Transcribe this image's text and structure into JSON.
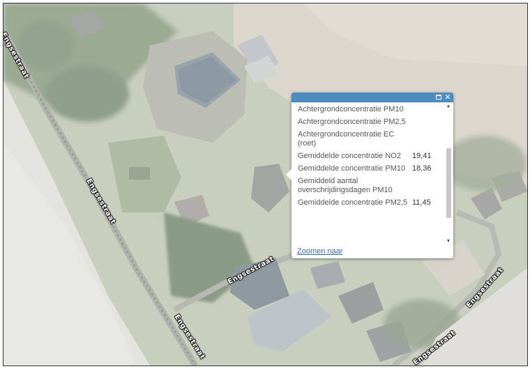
{
  "map": {
    "streets": [
      {
        "id": "street-label-1",
        "text": "Engsestraat"
      },
      {
        "id": "street-label-2",
        "text": "Engsestraat"
      },
      {
        "id": "street-label-3",
        "text": "Engsestraat"
      },
      {
        "id": "street-label-4",
        "text": "Engsestraat"
      },
      {
        "id": "street-label-5",
        "text": "Engsestraat"
      },
      {
        "id": "street-label-6",
        "text": "Engsestraat"
      }
    ]
  },
  "popup": {
    "rows": [
      {
        "label": "Achtergrondconcentratie PM10",
        "value": ""
      },
      {
        "label": "Achtergrondconcentratie PM2,5",
        "value": ""
      },
      {
        "label": "Achtergrondconcentratie EC (roet)",
        "value": ""
      },
      {
        "label": "Gemiddelde concentratie NO2",
        "value": "19,41"
      },
      {
        "label": "Gemiddelde concentratie PM10",
        "value": "18,36"
      },
      {
        "label": "Gemiddeld aantal overschrijdingsdagen PM10",
        "value": ""
      },
      {
        "label": "Gemiddelde concentratie PM2,5",
        "value": "11,45"
      }
    ],
    "zoom_link": "Zoomen naar",
    "header_color": "#4d8dbd"
  }
}
